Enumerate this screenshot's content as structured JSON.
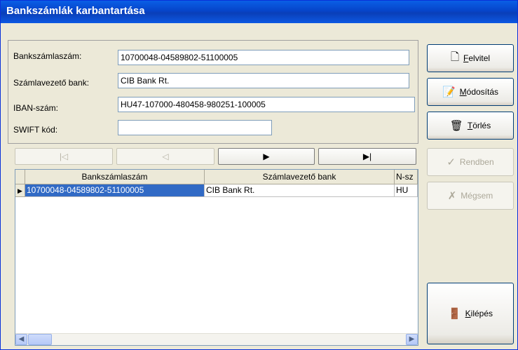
{
  "window": {
    "title": "Bankszámlák karbantartása"
  },
  "form": {
    "account_label": "Bankszámlaszám:",
    "account_value": "10700048-04589802-51100005",
    "bank_label": "Számlavezető bank:",
    "bank_value": "CIB Bank Rt.",
    "iban_label": "IBAN-szám:",
    "iban_value": "HU47-107000-480458-980251-100005",
    "swift_label": "SWIFT kód:",
    "swift_value": ""
  },
  "nav": {
    "first": "|◁",
    "prev": "◁",
    "next": "▶",
    "last": "▶|"
  },
  "grid": {
    "columns": [
      "Bankszámlaszám",
      "Számlavezető bank",
      "N-sz"
    ],
    "rows": [
      [
        "10700048-04589802-51100005",
        "CIB Bank Rt.",
        "HU"
      ]
    ],
    "current_row_marker": "▶"
  },
  "buttons": {
    "add": {
      "accel": "F",
      "rest": "elvitel",
      "icon": "new-document-icon"
    },
    "modify": {
      "accel": "M",
      "rest": "ódosítás",
      "icon": "edit-document-icon"
    },
    "delete": {
      "accel": "T",
      "rest": "örlés",
      "icon": "trash-icon"
    },
    "ok": {
      "label": "Rendben",
      "icon": "checkmark-icon"
    },
    "cancel": {
      "label": "Mégsem",
      "icon": "cross-icon"
    },
    "exit": {
      "accel": "K",
      "rest": "ilépés",
      "icon": "exit-door-icon"
    }
  },
  "colors": {
    "title_bar": "#0a5fe6",
    "selection": "#316ac5"
  }
}
